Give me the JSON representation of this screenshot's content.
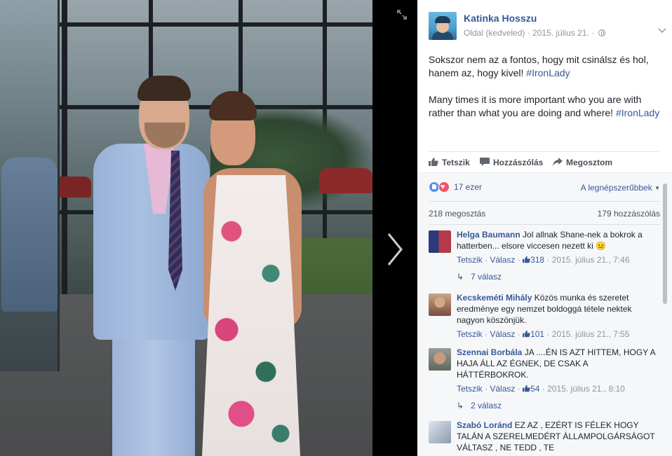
{
  "post": {
    "page_name": "Katinka Hosszu",
    "meta_prefix": "Oldal (kedveled) · ",
    "date": "2015. július 21.",
    "meta_suffix": " · ",
    "text_hu": "Sokszor nem az a fontos, hogy mit csinálsz és hol, hanem az, hogy kivel! ",
    "hashtag_hu": "#IronLady",
    "text_en": "Many times it is more important who you are with rather than what you are doing and where! ",
    "hashtag_en": "#IronLady"
  },
  "actions": {
    "like": "Tetszik",
    "comment": "Hozzászólás",
    "share": "Megosztom"
  },
  "feedback": {
    "reaction_count": "17 ezer",
    "sort_label": "A legnépszerűbbek",
    "shares": "218 megosztás",
    "comment_count": "179 hozzászólás"
  },
  "comments": [
    {
      "author": "Helga Baumann",
      "text": " Jol allnak Shane-nek a bokrok a hatterben... elsore viccesen nezett ki 😐",
      "like": "Tetszik",
      "reply": "Válasz",
      "likes": "318",
      "date": "2015. július 21., 7:46",
      "replies": "7 válasz"
    },
    {
      "author": "Kecskeméti Mihály",
      "text": " Közös munka és szeretet eredménye egy nemzet boldoggá tétele nektek nagyon köszönjük.",
      "like": "Tetszik",
      "reply": "Válasz",
      "likes": "101",
      "date": "2015. július 21., 7:55"
    },
    {
      "author": "Szennai Borbála",
      "text": " JA ....ÉN IS AZT HITTEM, HOGY A HAJA ÁLL AZ ÉGNEK, DE CSAK A HÁTTÉRBOKROK.",
      "like": "Tetszik",
      "reply": "Válasz",
      "likes": "54",
      "date": "2015. július 21., 8:10",
      "replies": "2 válasz"
    },
    {
      "author": "Szabó Loránd",
      "text": " EZ AZ , EZÉRT IS FÉLEK HOGY TALÁN A SZERELMEDÉRT ÁLLAMPOLGÁRSÁGOT VÁLTASZ , NE TEDD , TE"
    }
  ],
  "colors": {
    "link": "#365899",
    "meta": "#90949c",
    "viewer_bg": "#000000",
    "panel_bg": "#ffffff",
    "feedback_bg": "#f6f7f9"
  },
  "icons": [
    "expand-icon",
    "next-arrow-icon",
    "chevron-down-icon",
    "globe-icon",
    "thumbs-up-icon",
    "comment-icon",
    "share-icon",
    "like-reaction-icon",
    "love-reaction-icon",
    "reply-arrow-icon"
  ]
}
